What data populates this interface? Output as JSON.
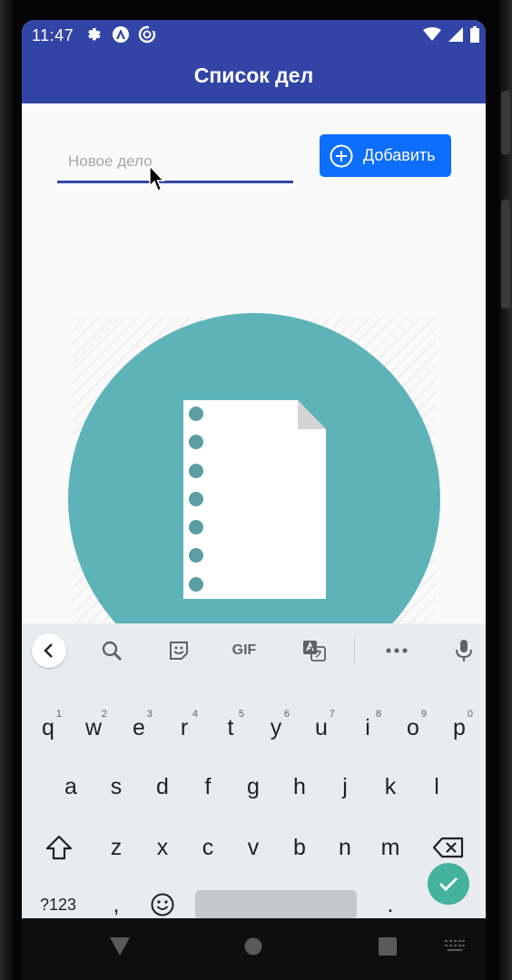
{
  "status_bar": {
    "time": "11:47",
    "left_icons": [
      "settings-icon",
      "accessibility-icon",
      "data-saver-icon"
    ],
    "right_icons": [
      "wifi-icon",
      "signal-icon",
      "battery-icon"
    ]
  },
  "app_bar": {
    "title": "Список дел"
  },
  "todo_input": {
    "placeholder": "Новое дело",
    "value": ""
  },
  "add_button": {
    "label": "Добавить",
    "icon": "add-circle-icon"
  },
  "illustration": {
    "icon": "notepad-icon",
    "colors": {
      "circle": "#5eb3b8",
      "paper": "#ffffff",
      "dots": "#5a9ea3",
      "fold": "#d4d4d4"
    }
  },
  "keyboard": {
    "toolbar": [
      {
        "name": "collapse-toolbar-button",
        "icon": "chevron-left-icon"
      },
      {
        "name": "search-button",
        "icon": "search-icon"
      },
      {
        "name": "sticker-button",
        "icon": "sticker-icon"
      },
      {
        "name": "gif-button",
        "label": "GIF"
      },
      {
        "name": "translate-button",
        "icon": "translate-icon"
      },
      {
        "name": "more-button",
        "icon": "more-horizontal-icon"
      },
      {
        "name": "voice-input-button",
        "icon": "microphone-icon"
      }
    ],
    "row1": [
      {
        "key": "q",
        "num": "1"
      },
      {
        "key": "w",
        "num": "2"
      },
      {
        "key": "e",
        "num": "3"
      },
      {
        "key": "r",
        "num": "4"
      },
      {
        "key": "t",
        "num": "5"
      },
      {
        "key": "y",
        "num": "6"
      },
      {
        "key": "u",
        "num": "7"
      },
      {
        "key": "i",
        "num": "8"
      },
      {
        "key": "o",
        "num": "9"
      },
      {
        "key": "p",
        "num": "0"
      }
    ],
    "row2": [
      "a",
      "s",
      "d",
      "f",
      "g",
      "h",
      "j",
      "k",
      "l"
    ],
    "row3": [
      "z",
      "x",
      "c",
      "v",
      "b",
      "n",
      "m"
    ],
    "symbols_key": "?123",
    "comma_key": ",",
    "period_key": "."
  },
  "colors": {
    "primary": "#3245a6",
    "button": "#0d6efd",
    "enter": "#45b29d",
    "keyboard_bg": "#e8ecef"
  }
}
